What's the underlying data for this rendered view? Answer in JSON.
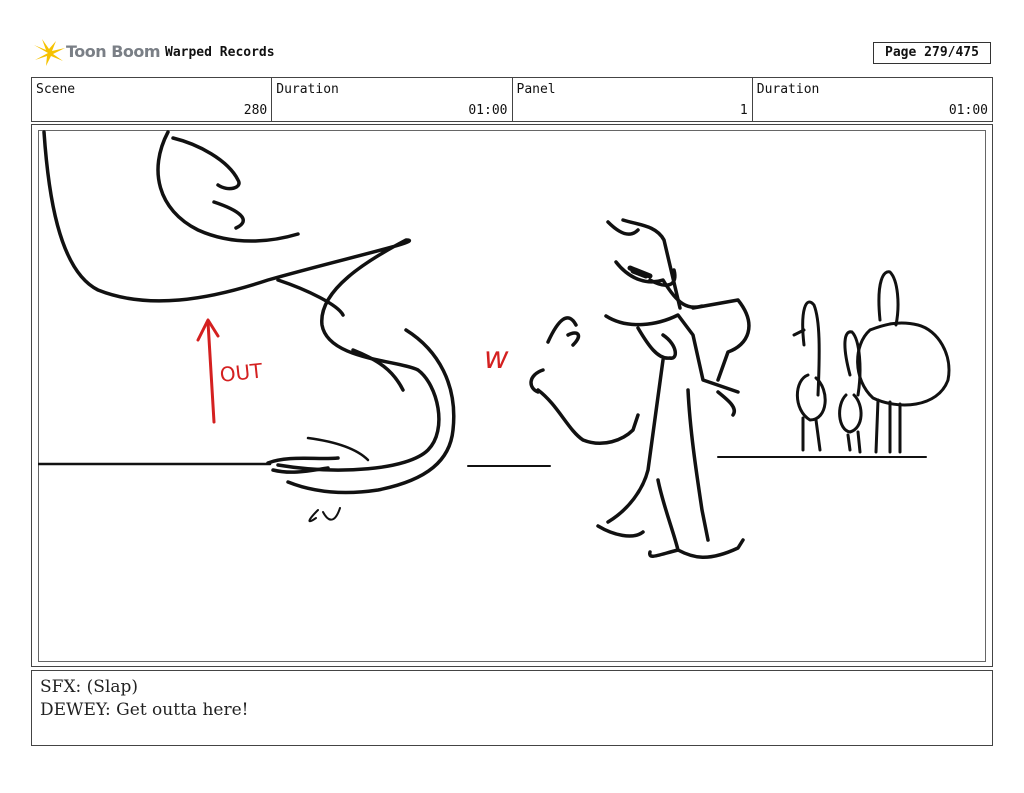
{
  "header": {
    "logo_text": "Toon Boom",
    "project_title": "Warped Records",
    "page_label": "Page 279/475"
  },
  "info": [
    {
      "label": "Scene",
      "value": "280"
    },
    {
      "label": "Duration",
      "value": "01:00"
    },
    {
      "label": "Panel",
      "value": "1"
    },
    {
      "label": "Duration",
      "value": "01:00"
    }
  ],
  "panel": {
    "annotation_text": "OUT",
    "sfx_text": "w"
  },
  "caption": {
    "line1": "SFX: (Slap)",
    "line2": "DEWEY: Get outta here!"
  },
  "colors": {
    "annotation": "#d42020",
    "logo_star": "#f6c200"
  }
}
